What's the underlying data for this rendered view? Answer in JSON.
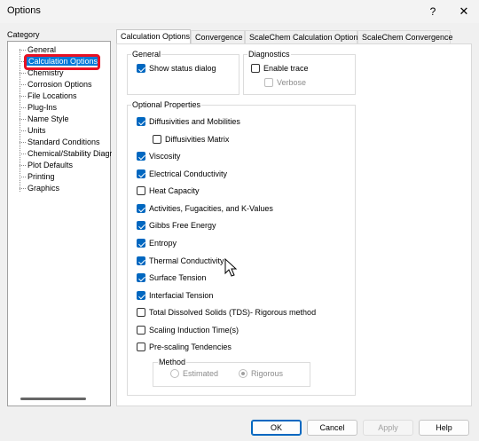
{
  "window": {
    "title": "Options",
    "help_glyph": "?",
    "close_glyph": "✕"
  },
  "category": {
    "label": "Category",
    "items": [
      {
        "label": "General"
      },
      {
        "label": "Calculation Options"
      },
      {
        "label": "Chemistry"
      },
      {
        "label": "Corrosion Options"
      },
      {
        "label": "File Locations"
      },
      {
        "label": "Plug-Ins"
      },
      {
        "label": "Name Style"
      },
      {
        "label": "Units"
      },
      {
        "label": "Standard Conditions"
      },
      {
        "label": "Chemical/Stability Diagra"
      },
      {
        "label": "Plot Defaults"
      },
      {
        "label": "Printing"
      },
      {
        "label": "Graphics"
      }
    ],
    "selected": "Calculation Options"
  },
  "tabs": [
    {
      "label": "Calculation Options",
      "active": true
    },
    {
      "label": "Convergence"
    },
    {
      "label": "ScaleChem Calculation Options"
    },
    {
      "label": "ScaleChem Convergence"
    }
  ],
  "general_group": {
    "title": "General",
    "show_status_dialog": {
      "label": "Show status dialog",
      "checked": true
    }
  },
  "diagnostics_group": {
    "title": "Diagnostics",
    "enable_trace": {
      "label": "Enable trace",
      "checked": false
    },
    "verbose": {
      "label": "Verbose",
      "checked": false,
      "disabled": true
    }
  },
  "optional_properties": {
    "title": "Optional Properties",
    "items": [
      {
        "label": "Diffusivities and Mobilities",
        "checked": true
      },
      {
        "label": "Diffusivities Matrix",
        "checked": false
      },
      {
        "label": "Viscosity",
        "checked": true
      },
      {
        "label": "Electrical Conductivity",
        "checked": true
      },
      {
        "label": "Heat Capacity",
        "checked": false
      },
      {
        "label": "Activities, Fugacities, and K-Values",
        "checked": true
      },
      {
        "label": "Gibbs Free Energy",
        "checked": true
      },
      {
        "label": "Entropy",
        "checked": true
      },
      {
        "label": "Thermal Conductivity",
        "checked": true
      },
      {
        "label": "Surface Tension",
        "checked": true
      },
      {
        "label": "Interfacial Tension",
        "checked": true
      },
      {
        "label": "Total Dissolved Solids (TDS)- Rigorous method",
        "checked": false
      },
      {
        "label": "Scaling Induction Time(s)",
        "checked": false
      },
      {
        "label": "Pre-scaling Tendencies",
        "checked": false
      }
    ],
    "method": {
      "title": "Method",
      "options": [
        {
          "label": "Estimated",
          "selected": false
        },
        {
          "label": "Rigorous",
          "selected": true
        }
      ]
    }
  },
  "buttons": {
    "ok": "OK",
    "cancel": "Cancel",
    "apply": "Apply",
    "help": "Help"
  },
  "colors": {
    "accent": "#0067c0",
    "selection": "#0078d7",
    "highlight_outline": "#e81123"
  }
}
